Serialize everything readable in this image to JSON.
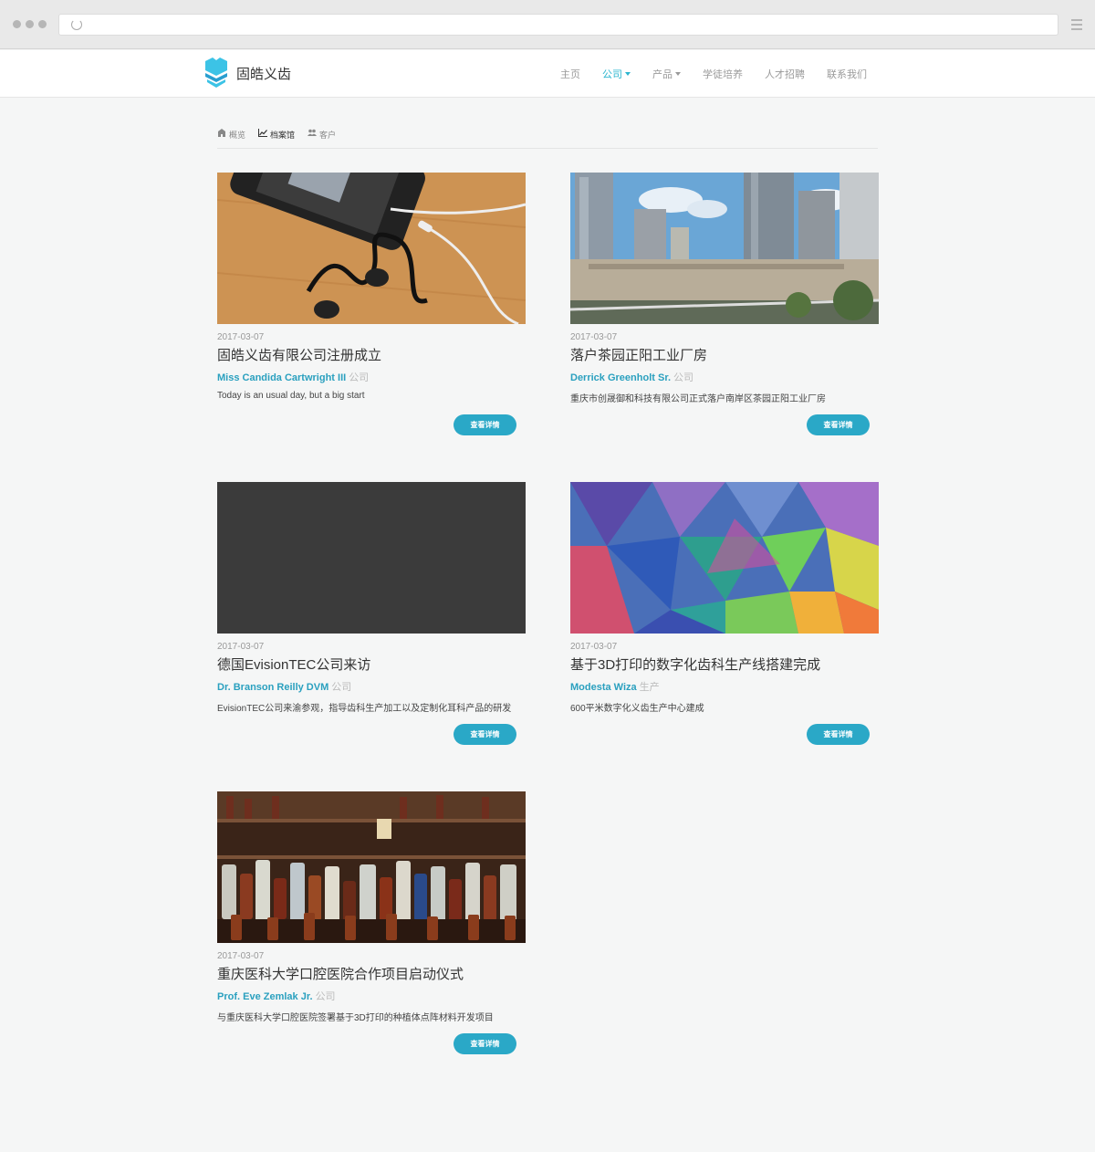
{
  "brand": {
    "name": "固皓义齿",
    "accent": "#2bb5cf"
  },
  "nav": {
    "items": [
      {
        "label": "主页"
      },
      {
        "label": "公司",
        "dropdown": true,
        "active": true
      },
      {
        "label": "产品",
        "dropdown": true
      },
      {
        "label": "学徒培养"
      },
      {
        "label": "人才招聘"
      },
      {
        "label": "联系我们"
      }
    ]
  },
  "subnav": [
    {
      "label": "概览",
      "icon": "home-icon"
    },
    {
      "label": "档案馆",
      "icon": "chart-icon",
      "active": true
    },
    {
      "label": "客户",
      "icon": "users-icon"
    }
  ],
  "posts": [
    {
      "date": "2017-03-07",
      "title": "固皓义齿有限公司注册成立",
      "author": "Miss Candida Cartwright III",
      "category": "公司",
      "desc": "Today is an usual day, but a big start",
      "button": "查看详情",
      "image": "phone-earphones-photo"
    },
    {
      "date": "2017-03-07",
      "title": "落户茶园正阳工业厂房",
      "author": "Derrick Greenholt Sr.",
      "category": "公司",
      "desc": "重庆市创晟御和科技有限公司正式落户南岸区茶园正阳工业厂房",
      "button": "查看详情",
      "image": "city-skyline-photo"
    },
    {
      "date": "2017-03-07",
      "title": "德国EvisionTEC公司来访",
      "author": "Dr. Branson Reilly DVM",
      "category": "公司",
      "desc": "EvisionTEC公司来渝参观，指导齿科生产加工以及定制化耳科产品的研发",
      "button": "查看详情",
      "image": "dark-placeholder"
    },
    {
      "date": "2017-03-07",
      "title": "基于3D打印的数字化齿科生产线搭建完成",
      "author": "Modesta Wiza",
      "category": "生产",
      "desc": "600平米数字化义齿生产中心建成",
      "button": "查看详情",
      "image": "colorful-polygon-art"
    },
    {
      "date": "2017-03-07",
      "title": "重庆医科大学口腔医院合作项目启动仪式",
      "author": "Prof. Eve Zemlak Jr.",
      "category": "公司",
      "desc": "与重庆医科大学口腔医院签署基于3D打印的种植体点阵材料开发项目",
      "button": "查看详情",
      "image": "bottles-shelf-photo"
    }
  ]
}
